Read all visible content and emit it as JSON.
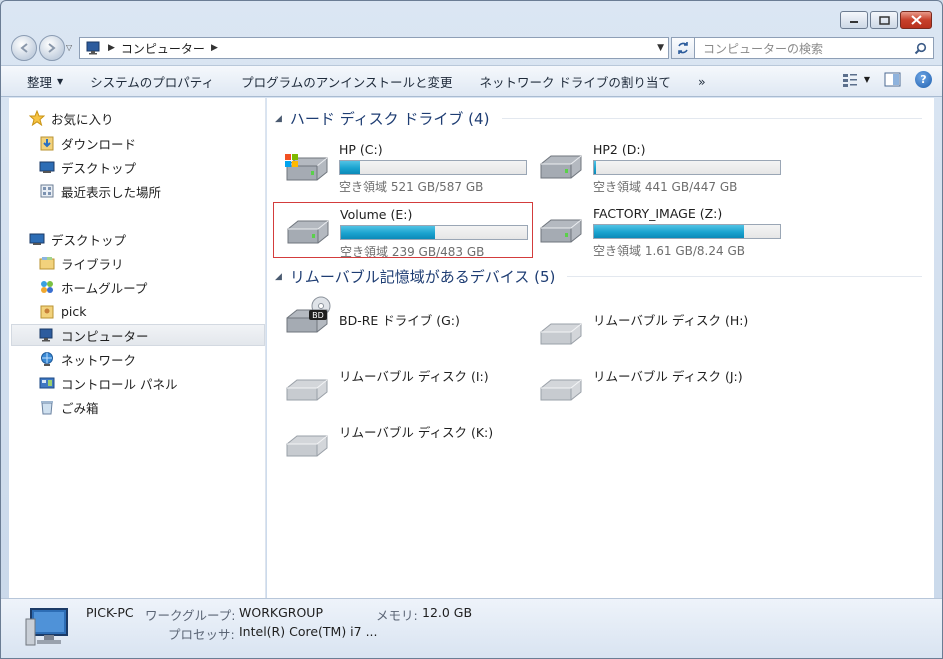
{
  "window": {
    "address": {
      "crumb": "コンピューター"
    },
    "search": {
      "placeholder": "コンピューターの検索"
    }
  },
  "toolbar": {
    "organize": "整理",
    "system_properties": "システムのプロパティ",
    "uninstall": "プログラムのアンインストールと変更",
    "map_drive": "ネットワーク ドライブの割り当て",
    "more": "»"
  },
  "nav": {
    "favorites": "お気に入り",
    "downloads": "ダウンロード",
    "desktop_fav": "デスクトップ",
    "recent": "最近表示した場所",
    "desktop": "デスクトップ",
    "libraries": "ライブラリ",
    "homegroup": "ホームグループ",
    "user": "pick",
    "computer": "コンピューター",
    "network": "ネットワーク",
    "control_panel": "コントロール パネル",
    "recycle_bin": "ごみ箱"
  },
  "hard_disks": {
    "header": "ハード ディスク ドライブ (4)",
    "items": [
      {
        "name": "HP (C:)",
        "free": "空き領域 521 GB/587 GB",
        "used_fraction": 0.11
      },
      {
        "name": "HP2 (D:)",
        "free": "空き領域 441 GB/447 GB",
        "used_fraction": 0.013
      },
      {
        "name": "Volume (E:)",
        "free": "空き領域 239 GB/483 GB",
        "used_fraction": 0.505
      },
      {
        "name": "FACTORY_IMAGE (Z:)",
        "free": "空き領域 1.61 GB/8.24 GB",
        "used_fraction": 0.805
      }
    ]
  },
  "removable": {
    "header": "リムーバブル記憶域があるデバイス (5)",
    "items": [
      {
        "name": "BD-RE ドライブ (G:)",
        "badge": "BD"
      },
      {
        "name": "リムーバブル ディスク (H:)"
      },
      {
        "name": "リムーバブル ディスク (I:)"
      },
      {
        "name": "リムーバブル ディスク (J:)"
      },
      {
        "name": "リムーバブル ディスク (K:)"
      }
    ]
  },
  "details": {
    "pc_name": "PICK-PC",
    "workgroup_label": "ワークグループ:",
    "workgroup": "WORKGROUP",
    "memory_label": "メモリ:",
    "memory": "12.0 GB",
    "processor_label": "プロセッサ:",
    "processor": "Intel(R) Core(TM) i7 ..."
  },
  "colors": {
    "accent": "#1e3d73",
    "bar_fill": "#1aa3cf",
    "highlight": "#d33c3c"
  }
}
